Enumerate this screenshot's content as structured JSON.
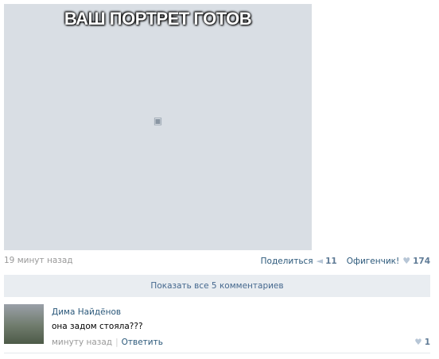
{
  "post": {
    "photo_caption": "ВАШ ПОРТРЕТ ГОТОВ",
    "time": "19 минут назад",
    "share_label": "Поделиться",
    "share_count": "11",
    "like_label": "Офигенчик!",
    "like_count": "174"
  },
  "comments_bar": {
    "label": "Показать все 5 комментариев"
  },
  "comment": {
    "author": "Дима Найдёнов",
    "text": "она задом стояла???",
    "time": "минуту назад",
    "reply_label": "Ответить",
    "like_count": "1"
  },
  "icons": {
    "share": "megaphone-icon",
    "like": "heart-icon"
  },
  "colors": {
    "link": "#2b587a",
    "muted": "#999999",
    "bar_bg": "#e9edf1"
  }
}
